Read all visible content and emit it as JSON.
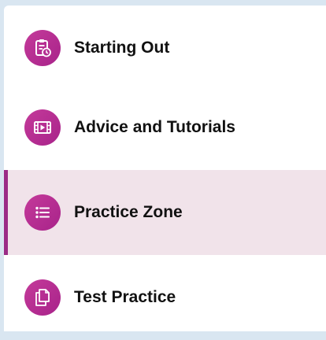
{
  "menu": {
    "items": [
      {
        "label": "Starting Out",
        "icon": "clipboard-clock-icon",
        "active": false
      },
      {
        "label": "Advice and Tutorials",
        "icon": "film-play-icon",
        "active": false
      },
      {
        "label": "Practice Zone",
        "icon": "list-icon",
        "active": true
      },
      {
        "label": "Test Practice",
        "icon": "copy-documents-icon",
        "active": false
      }
    ]
  },
  "colors": {
    "icon_circle": "#b52f92",
    "active_background": "#f1e3ea",
    "active_indicator": "#9b2c86",
    "page_background": "#d9e6f1"
  }
}
